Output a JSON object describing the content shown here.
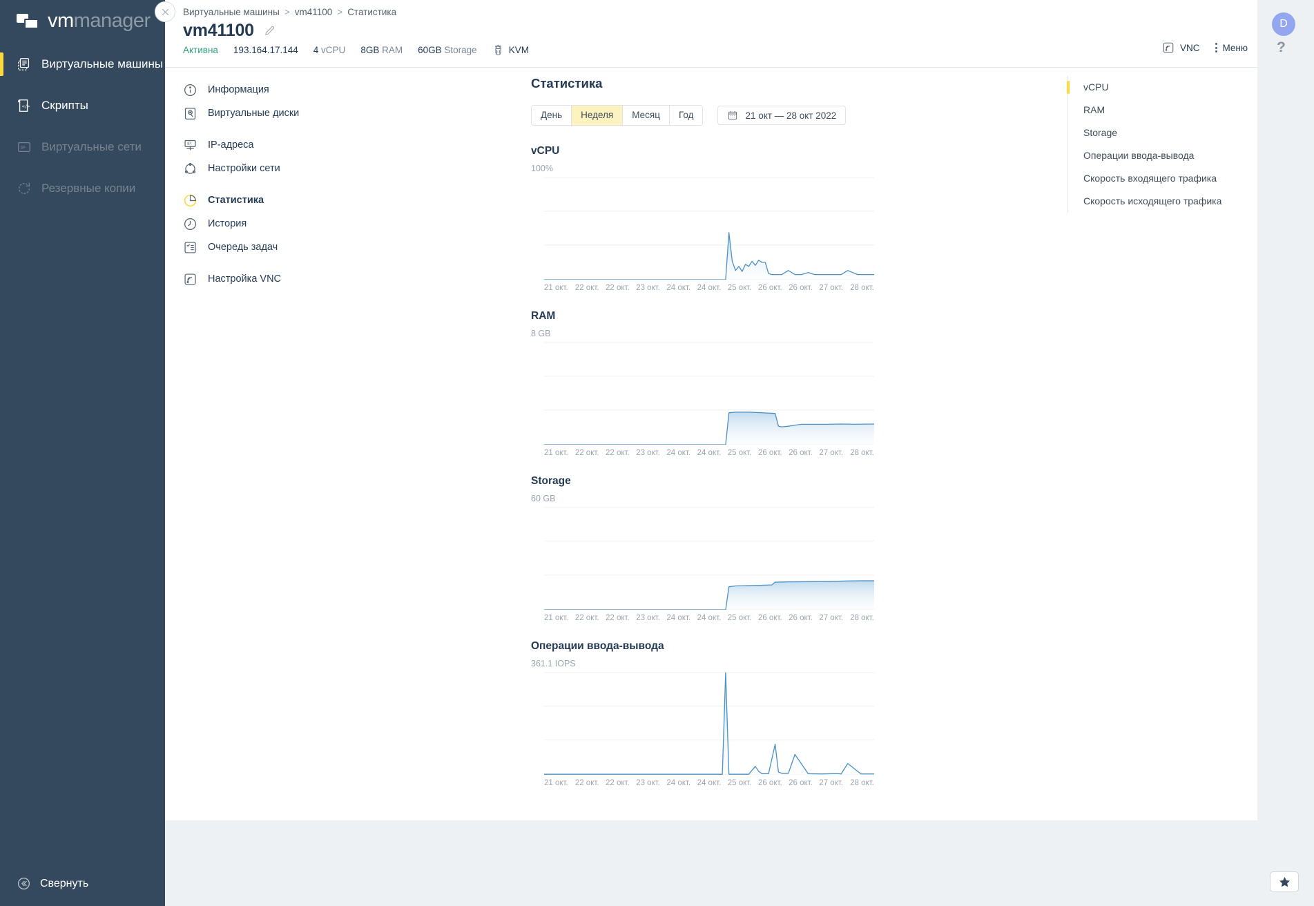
{
  "brand": {
    "vm": "vm",
    "manager": "manager"
  },
  "sidebar": {
    "items": [
      {
        "label": "Виртуальные машины",
        "icon": "servers-icon",
        "state": "active",
        "chevron": "›"
      },
      {
        "label": "Скрипты",
        "icon": "script-icon",
        "state": "normal"
      },
      {
        "label": "Виртуальные сети",
        "icon": "ip-network-icon",
        "state": "dim"
      },
      {
        "label": "Резервные копии",
        "icon": "backup-icon",
        "state": "dim"
      }
    ],
    "collapse_label": "Свернуть"
  },
  "header": {
    "breadcrumb": [
      "Виртуальные машины",
      "vm41100",
      "Статистика"
    ],
    "breadcrumb_separator": ">",
    "title": "vm41100",
    "meta": {
      "status": "Активна",
      "ip": "193.164.17.144",
      "vcpu_value": "4",
      "vcpu_unit": "vCPU",
      "ram_value": "8GB",
      "ram_unit": "RAM",
      "storage_value": "60GB",
      "storage_unit": "Storage",
      "hypervisor": "KVM"
    },
    "vnc_label": "VNC",
    "menu_label": "Меню"
  },
  "inner_menu": {
    "groups": [
      [
        {
          "label": "Информация",
          "icon": "info-icon"
        },
        {
          "label": "Виртуальные диски",
          "icon": "disk-icon"
        }
      ],
      [
        {
          "label": "IP-адреса",
          "icon": "ip-icon"
        },
        {
          "label": "Настройки сети",
          "icon": "network-icon"
        }
      ],
      [
        {
          "label": "Статистика",
          "icon": "statistics-icon",
          "active": true
        },
        {
          "label": "История",
          "icon": "history-icon"
        },
        {
          "label": "Очередь задач",
          "icon": "task-queue-icon"
        }
      ],
      [
        {
          "label": "Настройка VNC",
          "icon": "vnc-icon"
        }
      ]
    ]
  },
  "stats": {
    "heading": "Статистика",
    "period_options": [
      "День",
      "Неделя",
      "Месяц",
      "Год"
    ],
    "period_selected": "Неделя",
    "date_range": "21 окт — 28 окт 2022"
  },
  "right_nav": {
    "items": [
      {
        "label": "vCPU",
        "active": true
      },
      {
        "label": "RAM",
        "active": false
      },
      {
        "label": "Storage",
        "active": false
      },
      {
        "label": "Операции ввода-вывода",
        "active": false
      },
      {
        "label": "Скорость входящего трафика",
        "active": false
      },
      {
        "label": "Скорость исходящего трафика",
        "active": false
      }
    ]
  },
  "rail": {
    "avatar_initial": "D",
    "help": "?",
    "star": "★"
  },
  "colors": {
    "sidebar_bg": "#35495e",
    "accent_yellow": "#ffd83d",
    "segment_active": "#fdf3c0",
    "status_green": "#2fa37a",
    "chart_line": "#4a90c4",
    "text_dark": "#243b53",
    "text_muted": "#9aa5b1",
    "avatar_bg": "#93a7f0"
  },
  "chart_data": [
    {
      "type": "area",
      "title": "vCPU",
      "ylabel": "100%",
      "ymax_label": "100%",
      "ylim": [
        0,
        100
      ],
      "unit": "%",
      "grid": true,
      "xlabel": "",
      "tick_labels": [
        "21 окт.",
        "22 окт.",
        "22 окт.",
        "23 окт.",
        "24 окт.",
        "24 окт.",
        "25 окт.",
        "26 окт.",
        "26 окт.",
        "27 окт.",
        "28 окт."
      ],
      "x": [
        0,
        5,
        10,
        15,
        20,
        25,
        30,
        35,
        40,
        45,
        50,
        55,
        56,
        57,
        58,
        59,
        60,
        61,
        62,
        63,
        64,
        65,
        66,
        67,
        68,
        69,
        70,
        72,
        74,
        76,
        78,
        80,
        82,
        85,
        88,
        90,
        92,
        95,
        100
      ],
      "values": [
        0,
        0,
        0,
        0,
        0,
        0,
        0,
        0,
        0,
        0,
        0,
        0,
        46,
        18,
        9,
        13,
        8,
        15,
        13,
        18,
        14,
        19,
        17,
        17,
        6,
        5,
        5,
        5,
        9,
        5,
        5,
        7,
        5,
        5,
        5,
        5,
        9,
        5,
        5
      ]
    },
    {
      "type": "area",
      "title": "RAM",
      "ylabel": "8 GB",
      "ymax_label": "8 GB",
      "ylim": [
        0,
        8
      ],
      "unit": "GB",
      "grid": true,
      "xlabel": "",
      "tick_labels": [
        "21 окт.",
        "22 окт.",
        "22 окт.",
        "23 окт.",
        "24 окт.",
        "24 окт.",
        "25 окт.",
        "26 окт.",
        "26 окт.",
        "27 окт.",
        "28 окт."
      ],
      "x": [
        0,
        10,
        20,
        30,
        40,
        50,
        55,
        56,
        58,
        62,
        66,
        70,
        71,
        72,
        74,
        78,
        82,
        86,
        90,
        94,
        100
      ],
      "values": [
        0,
        0,
        0,
        0,
        0,
        0,
        0,
        2.5,
        2.55,
        2.55,
        2.5,
        2.45,
        1.45,
        1.4,
        1.45,
        1.6,
        1.6,
        1.6,
        1.62,
        1.6,
        1.62
      ]
    },
    {
      "type": "area",
      "title": "Storage",
      "ylabel": "60 GB",
      "ymax_label": "60 GB",
      "ylim": [
        0,
        60
      ],
      "unit": "GB",
      "grid": true,
      "xlabel": "",
      "tick_labels": [
        "21 окт.",
        "22 окт.",
        "22 окт.",
        "23 окт.",
        "24 окт.",
        "24 окт.",
        "25 окт.",
        "26 окт.",
        "26 окт.",
        "27 окт.",
        "28 окт."
      ],
      "x": [
        0,
        10,
        20,
        30,
        40,
        50,
        55,
        56,
        58,
        62,
        66,
        69,
        70,
        74,
        80,
        86,
        92,
        96,
        100
      ],
      "values": [
        0,
        0,
        0,
        0,
        0,
        0,
        0,
        13.5,
        14,
        14.2,
        14.4,
        14.6,
        16.2,
        16.4,
        16.5,
        16.6,
        16.9,
        17,
        17
      ]
    },
    {
      "type": "area",
      "title": "Операции ввода-вывода",
      "ylabel": "361.1 IOPS",
      "ymax_label": "361.1 IOPS",
      "ylim": [
        0,
        361.1
      ],
      "unit": "IOPS",
      "grid": true,
      "xlabel": "",
      "tick_labels": [
        "21 окт.",
        "22 окт.",
        "22 окт.",
        "23 окт.",
        "24 окт.",
        "24 окт.",
        "25 окт.",
        "26 окт.",
        "26 окт.",
        "27 окт.",
        "28 окт."
      ],
      "x": [
        0,
        10,
        20,
        30,
        40,
        50,
        54,
        55,
        56,
        57,
        58,
        62,
        64,
        65,
        66,
        68,
        70,
        71,
        72,
        74,
        76,
        80,
        84,
        88,
        89,
        90,
        92,
        96,
        100
      ],
      "values": [
        2,
        2,
        2,
        2,
        2,
        2,
        2,
        361.1,
        2,
        2,
        2,
        2,
        30,
        12,
        4,
        4,
        108,
        10,
        5,
        5,
        72,
        4,
        3,
        4,
        4,
        3,
        40,
        3,
        3
      ]
    }
  ]
}
